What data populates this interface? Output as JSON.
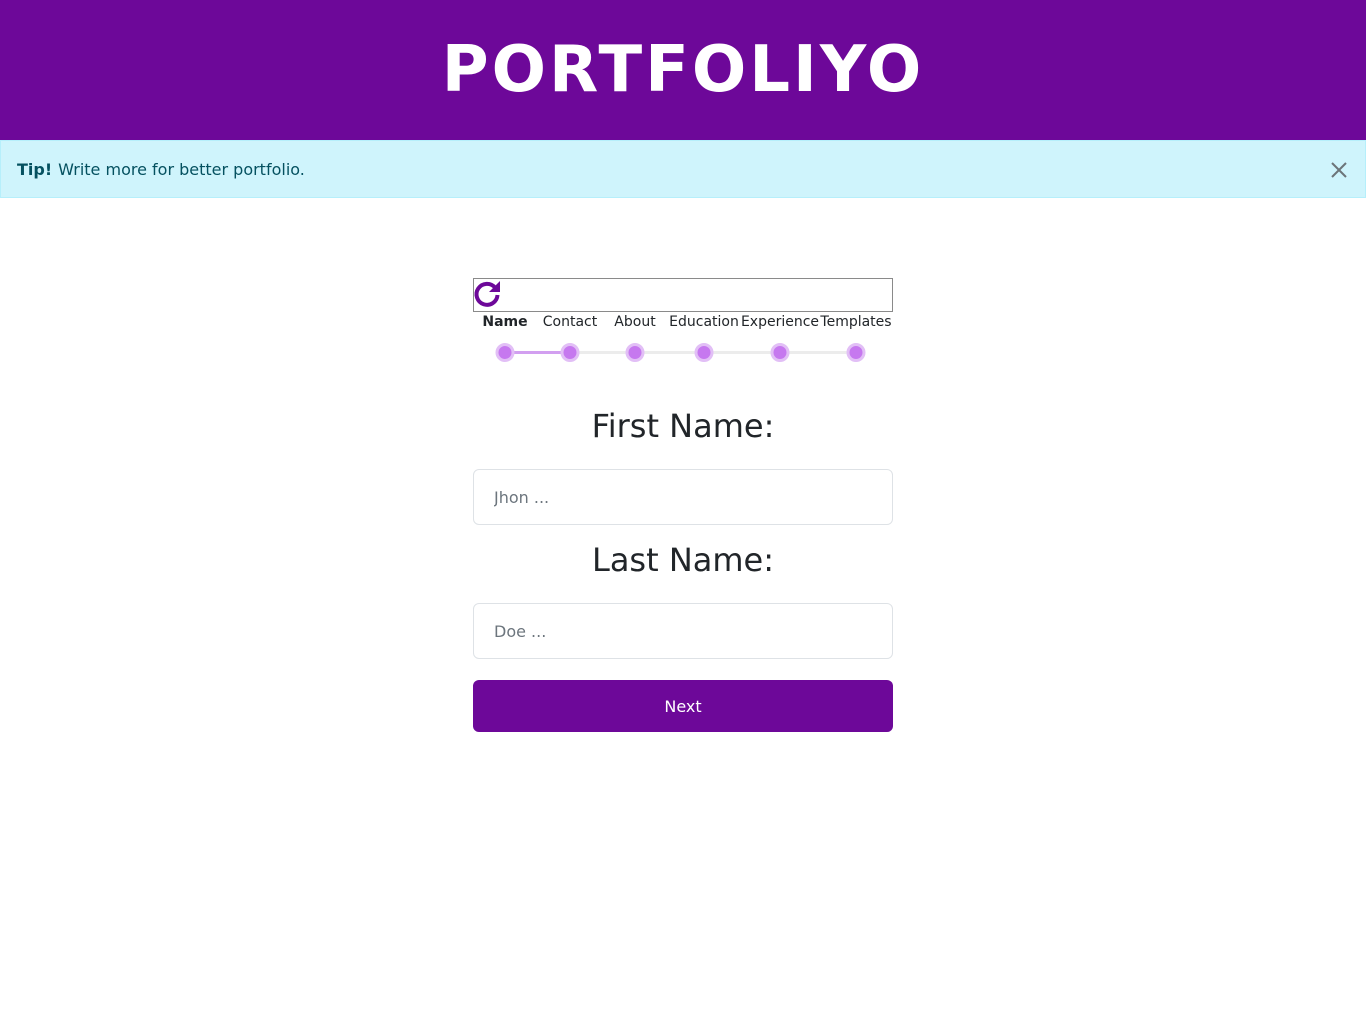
{
  "header": {
    "brand": "PORTFOLIYO"
  },
  "alert": {
    "strong": "Tip!",
    "text": "Write more for better portfolio.",
    "close_icon": "close-icon"
  },
  "reload": {
    "icon": "reload-icon"
  },
  "steps": {
    "current_index": 0,
    "items": [
      {
        "label": "Name"
      },
      {
        "label": "Contact"
      },
      {
        "label": "About"
      },
      {
        "label": "Education"
      },
      {
        "label": "Experience"
      },
      {
        "label": "Templates"
      }
    ]
  },
  "form": {
    "first_name": {
      "label": "First Name:",
      "placeholder": "Jhon ...",
      "value": ""
    },
    "last_name": {
      "label": "Last Name:",
      "placeholder": "Doe ...",
      "value": ""
    },
    "next_label": "Next"
  },
  "colors": {
    "brand": "#6d0899",
    "alert_bg": "#cff4fc",
    "alert_text": "#055160",
    "step_dot": "#c678ef",
    "step_progress": "#d29ff0"
  }
}
